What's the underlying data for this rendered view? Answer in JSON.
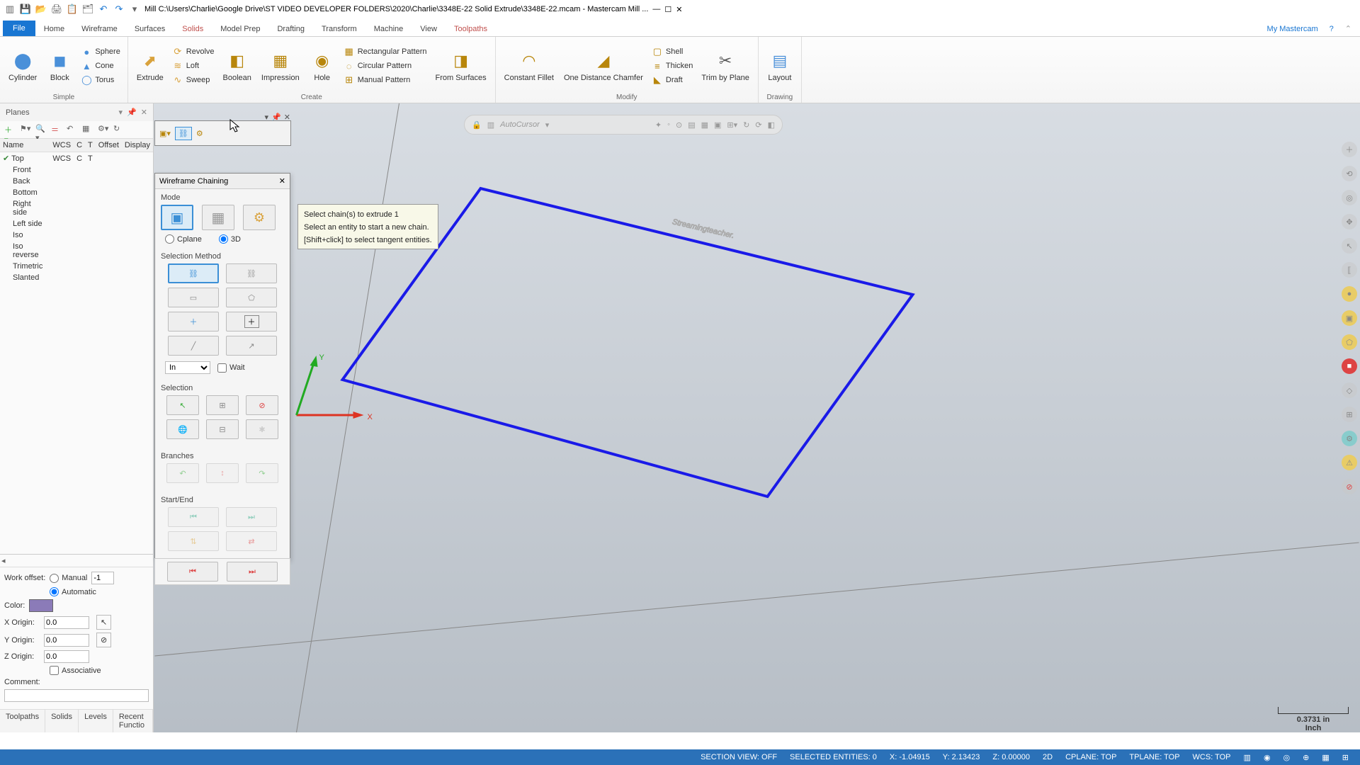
{
  "titlebar": {
    "product": "Mill",
    "path": "C:\\Users\\Charlie\\Google Drive\\ST VIDEO DEVELOPER FOLDERS\\2020\\Charlie\\3348E-22 Solid Extrude\\3348E-22.mcam - Mastercam Mill ..."
  },
  "tabs": {
    "file": "File",
    "home": "Home",
    "wireframe": "Wireframe",
    "surfaces": "Surfaces",
    "solids": "Solids",
    "modelprep": "Model Prep",
    "drafting": "Drafting",
    "transform": "Transform",
    "machine": "Machine",
    "view": "View",
    "toolpaths": "Toolpaths",
    "mymc": "My Mastercam"
  },
  "ribbon": {
    "simple": {
      "cylinder": "Cylinder",
      "block": "Block",
      "sphere": "Sphere",
      "cone": "Cone",
      "torus": "Torus",
      "group": "Simple"
    },
    "create": {
      "extrude": "Extrude",
      "revolve": "Revolve",
      "loft": "Loft",
      "sweep": "Sweep",
      "boolean": "Boolean",
      "impression": "Impression",
      "hole": "Hole",
      "rect": "Rectangular Pattern",
      "circ": "Circular Pattern",
      "manual": "Manual Pattern",
      "fromsurf": "From Surfaces",
      "group": "Create"
    },
    "modify": {
      "constfillet": "Constant Fillet",
      "onedist": "One Distance Chamfer",
      "shell": "Shell",
      "thicken": "Thicken",
      "draft": "Draft",
      "trim": "Trim by Plane",
      "group": "Modify"
    },
    "drawing": {
      "layout": "Layout",
      "group": "Drawing"
    }
  },
  "planes": {
    "title": "Planes",
    "cols": {
      "name": "Name",
      "wcs": "WCS",
      "c": "C",
      "t": "T",
      "offset": "Offset",
      "display": "Display"
    },
    "rows": [
      {
        "name": "Top",
        "wcs": "WCS",
        "c": "C",
        "t": "T"
      },
      {
        "name": "Front"
      },
      {
        "name": "Back"
      },
      {
        "name": "Bottom"
      },
      {
        "name": "Right side"
      },
      {
        "name": "Left side"
      },
      {
        "name": "Iso"
      },
      {
        "name": "Iso reverse"
      },
      {
        "name": "Trimetric"
      },
      {
        "name": "Slanted"
      }
    ],
    "workoffset": "Work offset:",
    "manual": "Manual",
    "automatic": "Automatic",
    "manualval": "-1",
    "color": "Color:",
    "colorval": "1",
    "xorigin": "X Origin:",
    "yorigin": "Y Origin:",
    "zorigin": "Z Origin:",
    "xv": "0.0",
    "yv": "0.0",
    "zv": "0.0",
    "associative": "Associative",
    "comment": "Comment:",
    "tabs": {
      "toolpaths": "Toolpaths",
      "solids": "Solids",
      "levels": "Levels",
      "recent": "Recent Functio"
    }
  },
  "dialog": {
    "title": "Wireframe Chaining",
    "mode": "Mode",
    "cplane": "Cplane",
    "threeD": "3D",
    "selmethod": "Selection Method",
    "in": "In",
    "wait": "Wait",
    "selection": "Selection",
    "branches": "Branches",
    "startend": "Start/End"
  },
  "prompt": {
    "l1": "Select chain(s) to extrude 1",
    "l2": "Select an entity to start a new chain.",
    "l3": "[Shift+click] to select tangent entities."
  },
  "autocursor": "AutoCursor",
  "scale": {
    "val": "0.3731 in",
    "unit": "Inch"
  },
  "status": {
    "section": "SECTION VIEW: OFF",
    "selent": "SELECTED ENTITIES: 0",
    "x": "X:   -1.04915",
    "y": "Y:   2.13423",
    "z": "Z:   0.00000",
    "dim": "2D",
    "cplane": "CPLANE: TOP",
    "tplane": "TPLANE: TOP",
    "wcs": "WCS: TOP"
  },
  "chart_data": {
    "type": "other"
  }
}
